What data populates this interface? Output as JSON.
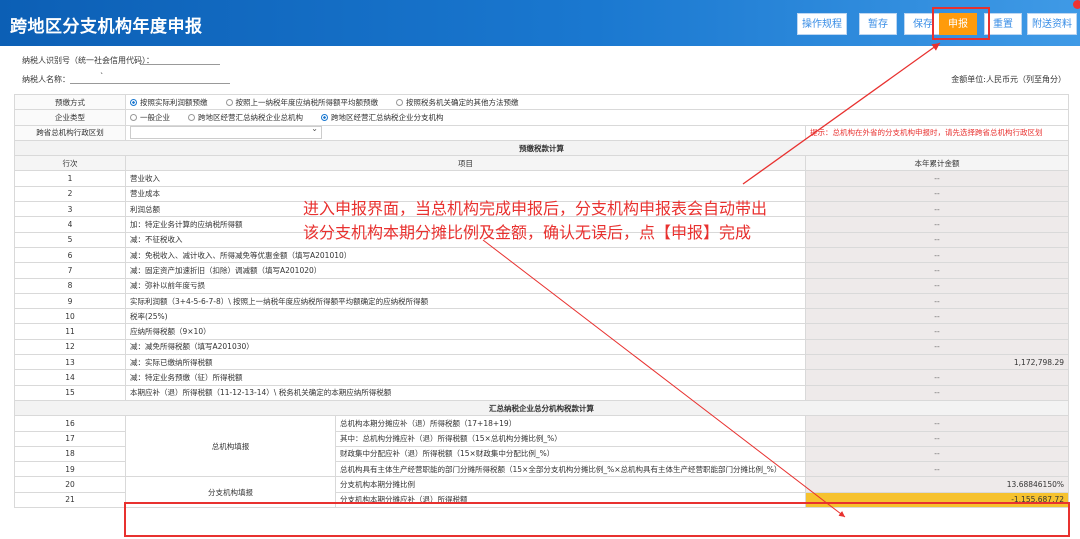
{
  "title": "跨地区分支机构年度申报",
  "toolbar": [
    {
      "label": "操作规程",
      "primary": false
    },
    {
      "label": "暂存",
      "primary": false
    },
    {
      "label": "保存",
      "primary": false
    },
    {
      "label": "申报",
      "primary": true
    },
    {
      "label": "重置",
      "primary": false
    },
    {
      "label": "附送资料",
      "primary": false
    }
  ],
  "meta": {
    "taxpayer_id_label": "纳税人识别号（统一社会信用代码）：",
    "taxpayer_name_label": "纳税人名称：",
    "taxpayer_name_value": "`",
    "unit_note": "金额单位:人民币元（列至角分）"
  },
  "form": {
    "prepay_label": "预缴方式",
    "prepay_options": [
      "按照实际利润额预缴",
      "按照上一纳税年度应纳税所得额平均额预缴",
      "按照税务机关确定的其他方法预缴"
    ],
    "prepay_selected": 0,
    "company_label": "企业类型",
    "company_options": [
      "一般企业",
      "跨地区经营汇总纳税企业总机构",
      "跨地区经营汇总纳税企业分支机构"
    ],
    "company_selected": 2,
    "region_label": "跨省总机构行政区划",
    "region_hint": "提示：总机构在外省的分支机构申报时，请先选择跨省总机构行政区划"
  },
  "section1_title": "预缴税款计算",
  "col_headers": {
    "row": "行次",
    "item": "项目",
    "amount": "本年累计金额"
  },
  "rows": [
    {
      "n": "1",
      "item": "营业收入",
      "amt": "--"
    },
    {
      "n": "2",
      "item": "营业成本",
      "amt": "--"
    },
    {
      "n": "3",
      "item": "利润总额",
      "amt": "--"
    },
    {
      "n": "4",
      "item": "加：特定业务计算的应纳税所得额",
      "amt": "--"
    },
    {
      "n": "5",
      "item": "减：不征税收入",
      "amt": "--"
    },
    {
      "n": "6",
      "item": "减：免税收入、减计收入、所得减免等优惠金额（填写A201010）",
      "amt": "--"
    },
    {
      "n": "7",
      "item": "减：固定资产加速折旧（扣除）调减额（填写A201020）",
      "amt": "--"
    },
    {
      "n": "8",
      "item": "减：弥补以前年度亏损",
      "amt": "--"
    },
    {
      "n": "9",
      "item": "实际利润额（3+4-5-6-7-8）\\ 按照上一纳税年度应纳税所得额平均额确定的应纳税所得额",
      "amt": "--"
    },
    {
      "n": "10",
      "item": "税率(25%)",
      "amt": "--"
    },
    {
      "n": "11",
      "item": "应纳所得税额（9×10）",
      "amt": "--"
    },
    {
      "n": "12",
      "item": "减：减免所得税额（填写A201030）",
      "amt": "--"
    },
    {
      "n": "13",
      "item": "减：实际已缴纳所得税额",
      "amt": "1,172,798.29"
    },
    {
      "n": "14",
      "item": "减：特定业务预缴（征）所得税额",
      "amt": "--"
    },
    {
      "n": "15",
      "item": "本期应补（退）所得税额（11-12-13-14）\\ 税务机关确定的本期应纳所得税额",
      "amt": "--"
    }
  ],
  "section2_title": "汇总纳税企业总分机构税款计算",
  "group_hq": "总机构填报",
  "group_branch": "分支机构填报",
  "rows2": [
    {
      "n": "16",
      "item": "总机构本期分摊应补（退）所得税额（17+18+19）",
      "amt": "--"
    },
    {
      "n": "17",
      "item": "其中：总机构分摊应补（退）所得税额（15×总机构分摊比例_%）",
      "amt": "--"
    },
    {
      "n": "18",
      "item": "财政集中分配应补（退）所得税额（15×财政集中分配比例_%）",
      "amt": "--"
    },
    {
      "n": "19",
      "item": "总机构具有主体生产经营职能的部门分摊所得税额（15×全部分支机构分摊比例_%×总机构具有主体生产经营职能部门分摊比例_%）",
      "amt": "--"
    },
    {
      "n": "20",
      "item": "分支机构本期分摊比例",
      "amt": "13.68846150%"
    },
    {
      "n": "21",
      "item": "分支机构本期分摊应补（退）所得税额",
      "amt": "-1,155,687.72"
    }
  ],
  "annotation": [
    "进入申报界面，当总机构完成申报后，分支机构申报表会自动带出",
    "该分支机构本期分摊比例及金额，确认无误后，点【申报】完成"
  ]
}
